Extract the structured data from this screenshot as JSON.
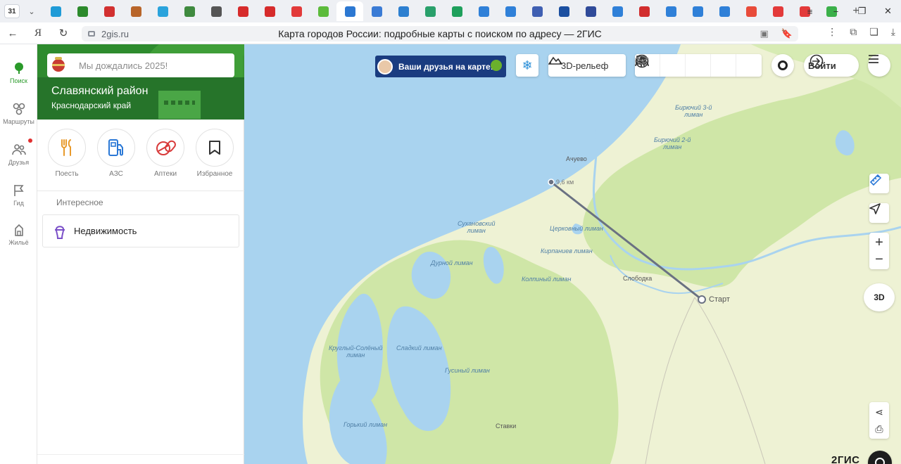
{
  "browser": {
    "calendar_tab": "31",
    "tab_favicons": [
      "#1f9bd7",
      "#2c8a2c",
      "#d23030",
      "#b8652a",
      "#2aa3dc",
      "#3f8a3f",
      "#555555",
      "#d62b2b",
      "#d62b2b",
      "#e23a3a",
      "#5cbb3c",
      "#2c78d2",
      "#3a7bd5",
      "#2c7fd0",
      "#29a06b",
      "#1fa05c",
      "#2f80d8",
      "#2f80d8",
      "#3f5fb2",
      "#1b4fa0",
      "#2f4a99",
      "#2f80d8",
      "#d12d2d",
      "#2f80d8",
      "#2f80d8",
      "#2f80d8",
      "#e84b3a",
      "#e33a3a",
      "#e33a3a",
      "#3bb04a"
    ],
    "address": {
      "host": "2gis.ru",
      "page_title": "Карта городов России: подробные карты с поиском по адресу — 2ГИС"
    }
  },
  "rail": {
    "items": [
      {
        "label": "Поиск",
        "icon": "search-pin-icon",
        "active": true
      },
      {
        "label": "Маршруты",
        "icon": "routes-icon"
      },
      {
        "label": "Друзья",
        "icon": "friends-icon",
        "badge": true
      },
      {
        "label": "Гид",
        "icon": "guide-flag-icon"
      },
      {
        "label": "Жильё",
        "icon": "housing-icon"
      }
    ]
  },
  "panel": {
    "search_placeholder": "Мы дождались 2025!",
    "region_title": "Славянский район",
    "region_subtitle": "Краснодарский край",
    "categories": [
      {
        "label": "Поесть",
        "icon": "fork-knife-icon",
        "color": "#e89a2c"
      },
      {
        "label": "АЗС",
        "icon": "fuel-icon",
        "color": "#2a78d6"
      },
      {
        "label": "Аптеки",
        "icon": "pill-icon",
        "color": "#d83a3a"
      },
      {
        "label": "Избранное",
        "icon": "bookmark-icon",
        "color": "#333333"
      }
    ],
    "interest_heading": "Интересное",
    "interest_items": [
      {
        "label": "Недвижимость",
        "icon": "real-estate-icon",
        "color": "#7a4fc8"
      }
    ]
  },
  "map": {
    "promo_text": "Ваши друзья на карте!",
    "relief_label": "3D-рельеф",
    "login_label": "Войти",
    "three_d_label": "3D",
    "brand": "2ГИС",
    "distance_label": "9,6 км",
    "start_label": "Старт",
    "place_labels": {
      "achuevo": "Ачуево",
      "sloboda": "Слободка",
      "stavki": "Ставки",
      "biruchy3": "Бирючий 3-й\nлиман",
      "biruchy2": "Бирючий 2-й\nлиман",
      "sukhanovsky": "Сухановский\nлиман",
      "tserkovny": "Церковный лиман",
      "kirpaniev": "Кирпаниев лиман",
      "durnoy": "Дурной лиман",
      "kolpiny": "Колпиный лиман",
      "kruglyi": "Круглый-Солёный\nлиман",
      "sladky": "Сладкий лиман",
      "gusiny": "Гусиный лиман",
      "gorky": "Горький лиман"
    },
    "colors": {
      "sea": "#a9d3ef",
      "land": "#eef2d4",
      "forest": "#cfe6a7",
      "route": "#6a7182"
    }
  }
}
